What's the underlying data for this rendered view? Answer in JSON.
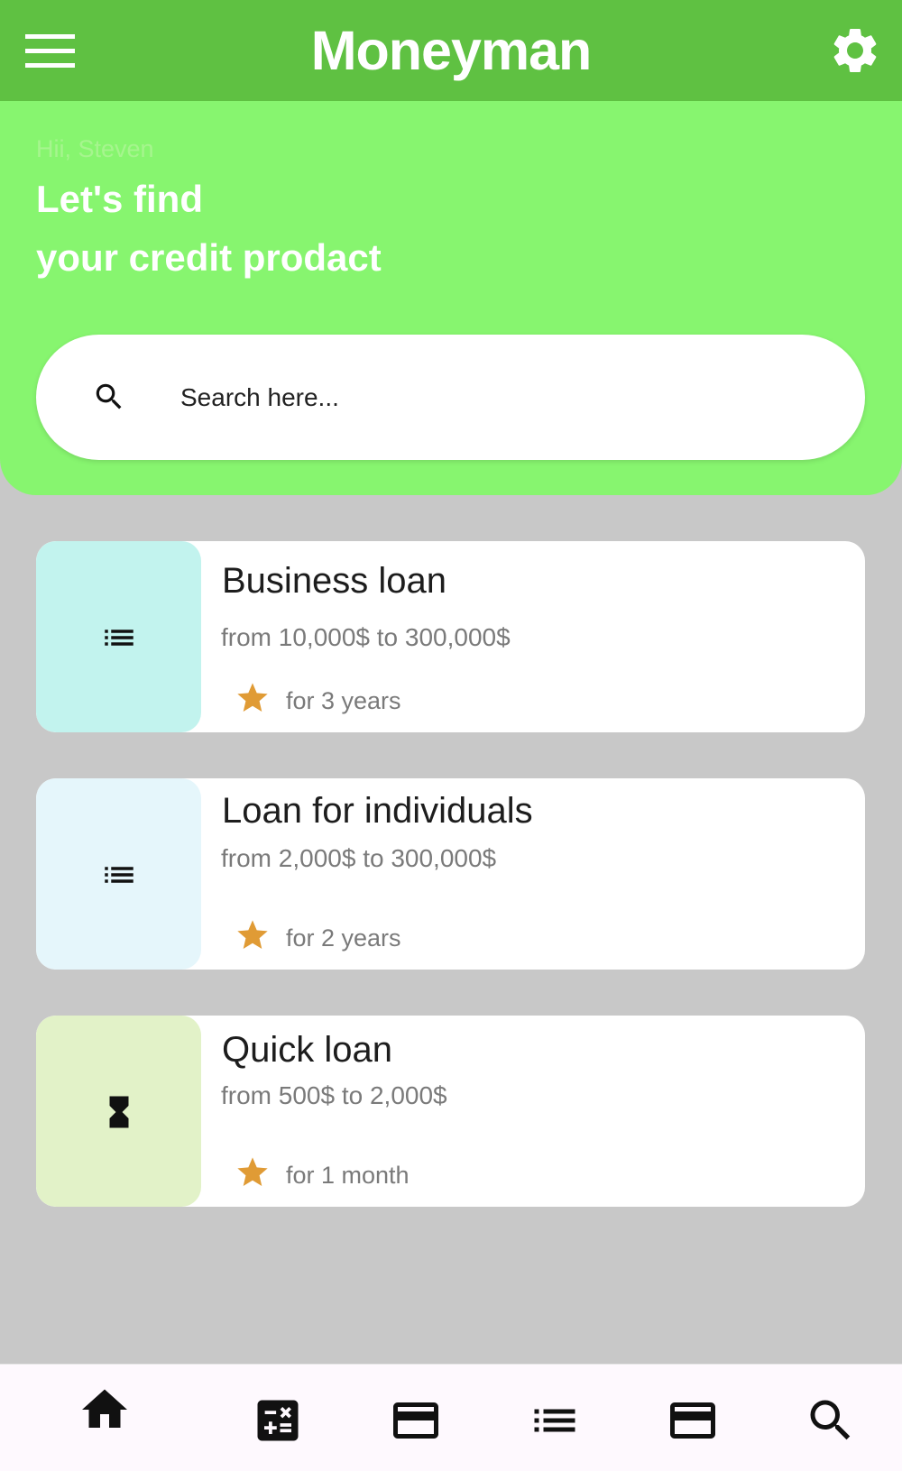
{
  "app_bar": {
    "title": "Moneyman",
    "color": "#5fc142"
  },
  "hero": {
    "greeting": "Hii, Steven",
    "heading_line1": "Let's find",
    "heading_line2": "your credit prodact",
    "color": "#87f56f"
  },
  "search": {
    "placeholder": "Search here...",
    "icon": "search-icon"
  },
  "loans": [
    {
      "title": "Business loan",
      "range": "from 10,000$ to 300,000$",
      "term": "for 3 years",
      "icon": "list-icon",
      "thumb_color": "#c2f3ee"
    },
    {
      "title": "Loan for individuals",
      "range": "from 2,000$ to 300,000$",
      "term": "for 2 years",
      "icon": "list-icon",
      "thumb_color": "#e5f6fb"
    },
    {
      "title": "Quick loan",
      "range": "from 500$ to 2,000$",
      "term": "for 1 month",
      "icon": "hourglass-icon",
      "thumb_color": "#e2f2c8"
    }
  ],
  "bottom_nav": [
    {
      "icon": "home-icon"
    },
    {
      "icon": "calculator-icon"
    },
    {
      "icon": "credit-card-icon"
    },
    {
      "icon": "list-icon"
    },
    {
      "icon": "credit-card-icon"
    },
    {
      "icon": "search-icon"
    }
  ],
  "colors": {
    "star": "#e09b35",
    "background": "#c8c8c8"
  }
}
